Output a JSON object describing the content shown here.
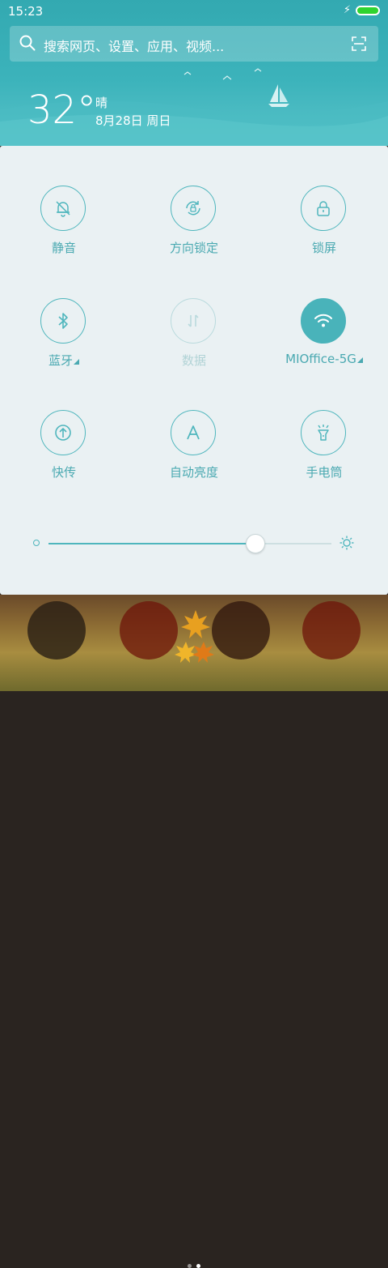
{
  "status_bar": {
    "time": "15:23"
  },
  "search": {
    "placeholder": "搜索网页、设置、应用、视频..."
  },
  "weather": {
    "temperature": "32°",
    "condition": "晴",
    "date": "8月28日 周日"
  },
  "tiles": [
    {
      "label": "静音",
      "icon": "bell-off-icon",
      "state": "off"
    },
    {
      "label": "方向锁定",
      "icon": "rotation-lock-icon",
      "state": "off"
    },
    {
      "label": "锁屏",
      "icon": "lock-icon",
      "state": "off"
    },
    {
      "label": "蓝牙",
      "icon": "bluetooth-icon",
      "state": "off",
      "expandable": true
    },
    {
      "label": "数据",
      "icon": "mobile-data-icon",
      "state": "disabled"
    },
    {
      "label": "MIOffice-5G",
      "icon": "wifi-icon",
      "state": "on",
      "expandable": true
    },
    {
      "label": "快传",
      "icon": "quick-transfer-icon",
      "state": "off"
    },
    {
      "label": "自动亮度",
      "icon": "auto-brightness-icon",
      "state": "off"
    },
    {
      "label": "手电筒",
      "icon": "flashlight-icon",
      "state": "off"
    }
  ],
  "brightness": {
    "level": 0.73
  },
  "colors": {
    "accent": "#49b3ba",
    "header": "#3cb3bb",
    "panel": "#eaf1f3",
    "label": "#4aa9b1"
  },
  "pager": {
    "pages": 2,
    "current": 2
  }
}
